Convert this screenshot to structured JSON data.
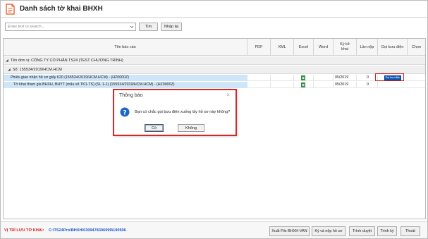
{
  "window": {
    "title": "Danh sách tờ khai BHXH",
    "accent": "#e8541e"
  },
  "search": {
    "placeholder": "Enter text to search...",
    "search_label": "Tìm",
    "reset_label": "Nhập lại"
  },
  "table": {
    "columns": [
      "Tên báo cáo",
      "PDF",
      "XML",
      "Excel",
      "Word",
      "Kỳ kê khai",
      "Lần nộp",
      "Gọi bưu điện",
      "Chọn"
    ],
    "group_company": "Tên đơn vị: CÔNG TY CỔ PHẦN TS24 (TEST CHƯƠNG TRÌNH)",
    "group_doc": "Số: 155534/2019/HCM.HCM",
    "rows": [
      {
        "name": "Phiếu giao nhận hồ sơ giấy 620 (155534/2019/HCM.HCM) - (HZ0000Z)",
        "excel_icon": "excel-icon",
        "period": "05/2019",
        "submit_count": "0",
        "post_button": "Gọi bưu điện"
      },
      {
        "name": "Tờ khai tham gia BHXH, BHYT (mẫu số TK1-TS) (SL 1-1) (155534/2019/HCM.HCM) - (HZ0000Z)",
        "excel_icon": "excel-icon",
        "period": "05/2019",
        "submit_count": "0"
      }
    ]
  },
  "dialog": {
    "title": "Thông báo",
    "message": "Bạn có chắc gọi bưu điện xuống lấy hồ sơ này không?",
    "yes_label": "Có",
    "no_label": "Không",
    "icon": "question-icon",
    "highlight_color": "#cf2b2b"
  },
  "footer": {
    "path_label": "VỊ TRÍ LƯU TỜ KHAI:",
    "path_value": "C:\\TS24Pro\\BHXH\\0309478306999\\190506",
    "buttons": {
      "export": "Xuất File BHXH-VAN",
      "sign_submit": "Ký và nộp hồ sơ",
      "browse": "Trình duyệt",
      "sign": "Trình ký",
      "exit": "Thoát"
    }
  }
}
